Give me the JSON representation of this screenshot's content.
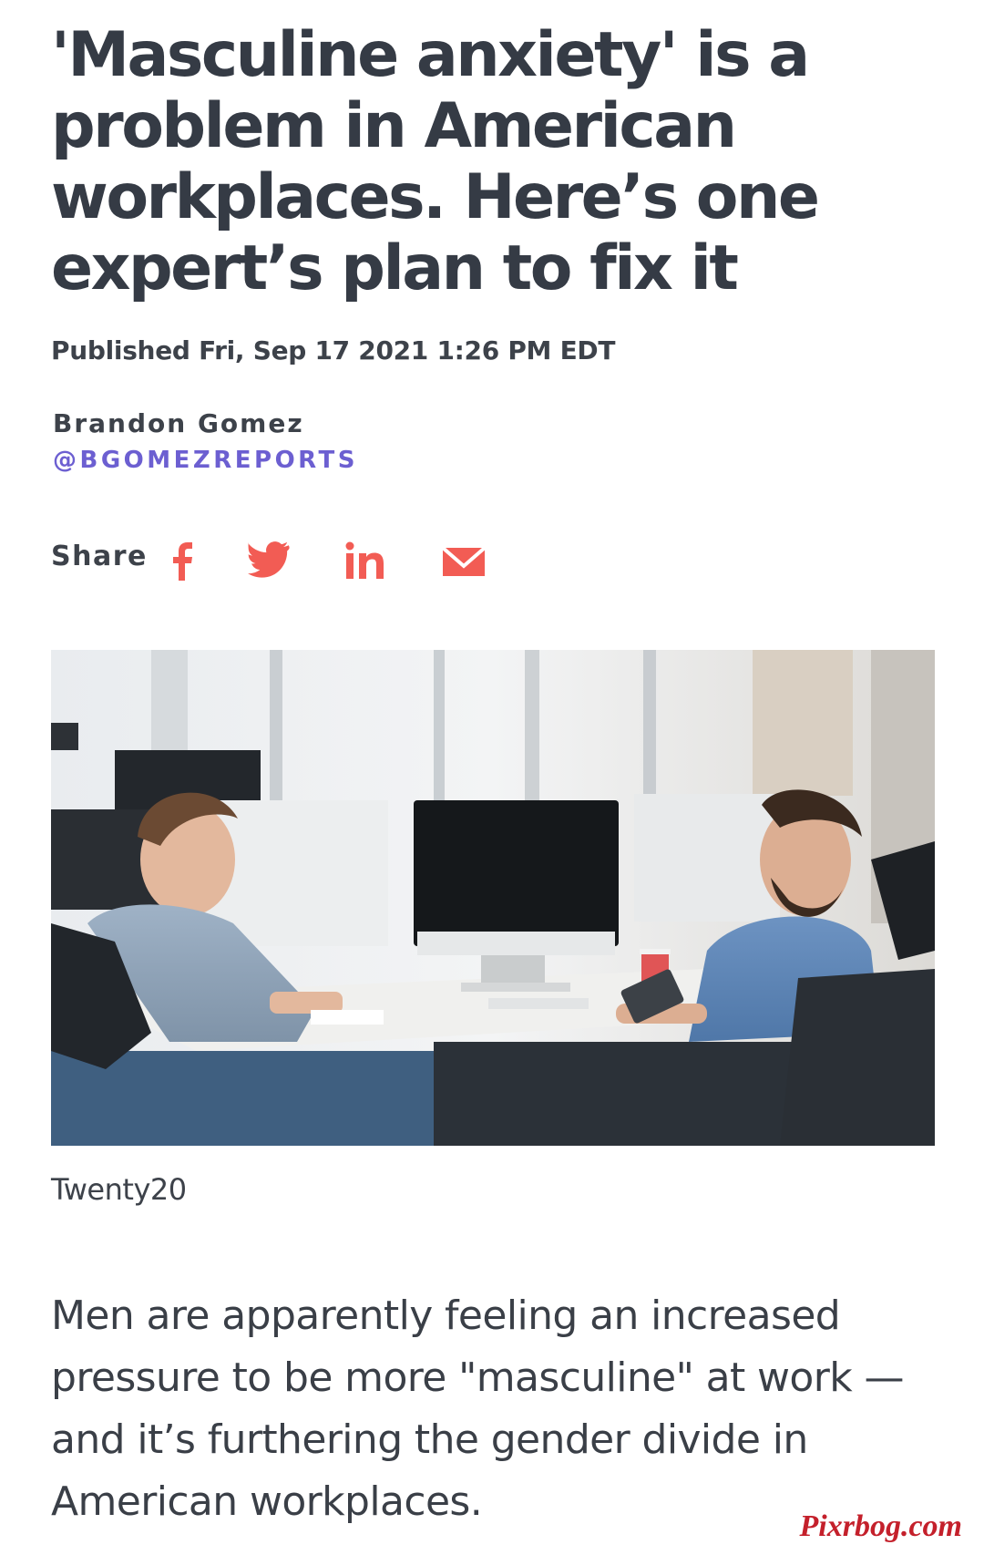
{
  "article": {
    "headline": "'Masculine anxiety' is a problem in American workplaces. Here’s one expert’s plan to fix it",
    "published": "Published Fri, Sep 17 2021 1:26 PM EDT",
    "author": {
      "name": "Brandon Gomez",
      "handle": "@BGOMEZREPORTS"
    },
    "share": {
      "label": "Share",
      "icons": [
        "facebook-icon",
        "twitter-icon",
        "linkedin-icon",
        "email-icon"
      ],
      "icon_color": "#f25c54"
    },
    "image": {
      "caption": "Twenty20"
    },
    "lede": "Men are apparently feeling an increased pressure to be more \"masculine\" at work — and it’s furthering the gender divide in American workplaces."
  },
  "watermark": "Pixrbog.com",
  "colors": {
    "text": "#3a3f47",
    "handle": "#6c5fd1",
    "share_icons": "#f25c54",
    "watermark": "#c4202b"
  }
}
